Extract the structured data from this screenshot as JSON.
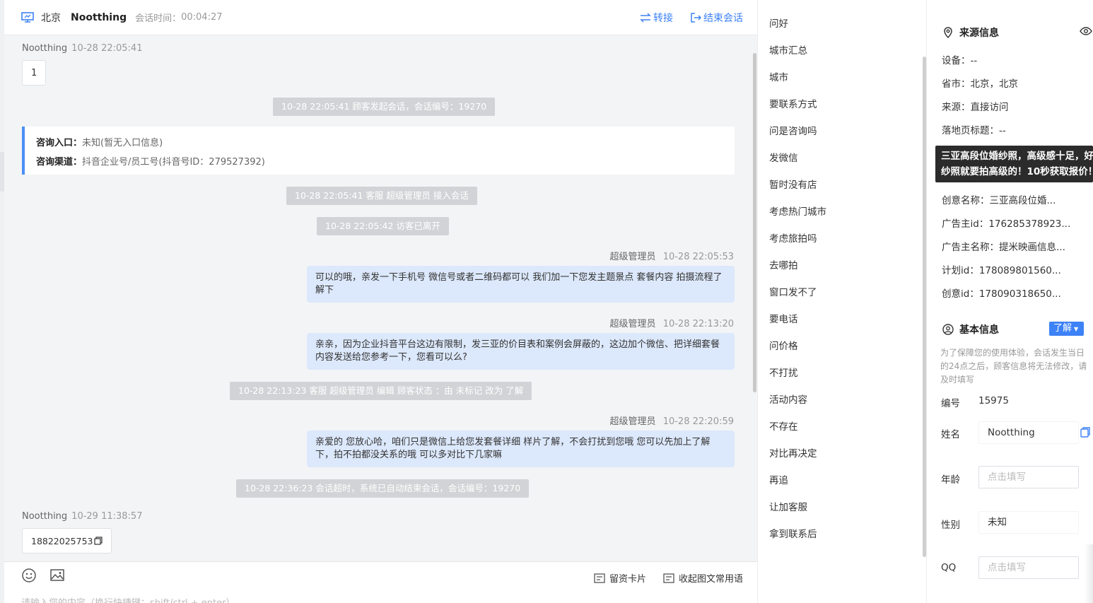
{
  "header": {
    "city": "北京",
    "name": "Nootthing",
    "time_label": "会话时间：",
    "time": "00:04:27",
    "transfer": "转接",
    "end": "结束会话"
  },
  "messages": {
    "m1": {
      "who": "Nootthing",
      "time": "10-28 22:05:41",
      "text": "1"
    },
    "sys1": "10-28 22:05:41 顾客发起会话，会话编号：19270",
    "card": {
      "entry_label": "咨询入口：",
      "entry_value": "未知(暂无入口信息)",
      "channel_label": "咨询渠道：",
      "channel_value": "抖音企业号/员工号(抖音号ID：279527392)"
    },
    "sys2": "10-28 22:05:41 客服 超级管理员 接入会话",
    "sys3": "10-28 22:05:42 访客已离开",
    "m2": {
      "who": "超级管理员",
      "time": "10-28 22:05:53",
      "text": "可以的哦，亲发一下手机号 微信号或者二维码都可以 我们加一下您发主题景点 套餐内容 拍摄流程了解下"
    },
    "m3": {
      "who": "超级管理员",
      "time": "10-28 22:13:20",
      "text": "亲亲，因为企业抖音平台这边有限制，发三亚的价目表和案例会屏蔽的，这边加个微信、把详细套餐内容发送给您参考一下，您看可以么?"
    },
    "sys4": "10-28 22:13:23 客服 超级管理员 编辑 顾客状态 ：由 未标记 改为 了解",
    "m4": {
      "who": "超级管理员",
      "time": "10-28 22:20:59",
      "text": "亲爱的 您放心哈，咱们只是微信上给您发套餐详细 样片了解，不会打扰到您哦 您可以先加上了解下，拍不拍都没关系的哦 可以多对比下几家嘛"
    },
    "sys5": "10-28 22:36:23 会话超时，系统已自动结束会话，会话编号：19270",
    "m5": {
      "who": "Nootthing",
      "time": "10-29 11:38:57",
      "text": "18822025753"
    }
  },
  "composer": {
    "placeholder": "请输入您的内容（换行快捷键：shift/ctrl + enter）",
    "card_btn": "留资卡片",
    "collapse_btn": "收起图文常用语"
  },
  "phrases": [
    "问好",
    "城市汇总",
    "城市",
    "要联系方式",
    "问是咨询吗",
    "发微信",
    "暂时没有店",
    "考虑热门城市",
    "考虑旅拍吗",
    "去哪拍",
    "窗口发不了",
    "要电话",
    "问价格",
    "不打扰",
    "活动内容",
    "不存在",
    "对比再决定",
    "再追",
    "让加客服",
    "拿到联系后"
  ],
  "source": {
    "title": "来源信息",
    "device": "设备：--",
    "province": "省市：北京，北京",
    "origin": "来源：直接访问",
    "landing": "落地页标题：--",
    "creative": "创意名称：三亚高段位婚...",
    "adv_id": "广告主id：176285378923...",
    "adv_name": "广告主名称：提米映画信息...",
    "plan_id": "计划id：178089801560...",
    "creative_id": "创意id：178090318650...",
    "tooltip_line1": "三亚高段位婚纱照，高级感十足，好",
    "tooltip_line2": "纱照就要拍高级的！10秒获取报价！"
  },
  "basic": {
    "title": "基本信息",
    "understand": "了解",
    "hint": "为了保障您的使用体验，会话发生当日的24点之后，顾客信息将无法修改，请及时填写",
    "id_label": "编号",
    "id_value": "15975",
    "name_label": "姓名",
    "name_value": "Nootthing",
    "age_label": "年龄",
    "age_placeholder": "点击填写",
    "gender_label": "性别",
    "gender_value": "未知",
    "qq_label": "QQ",
    "qq_placeholder": "点击填写"
  }
}
